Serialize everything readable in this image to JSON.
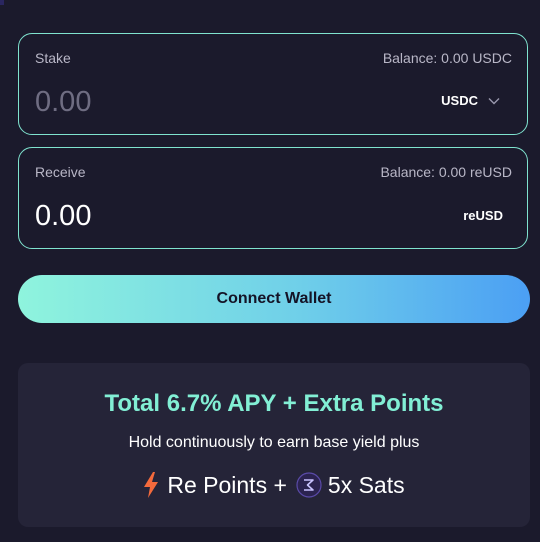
{
  "stake": {
    "label": "Stake",
    "balance": "Balance: 0.00 USDC",
    "amount_placeholder": "0.00",
    "amount_value": "",
    "token": "USDC"
  },
  "receive": {
    "label": "Receive",
    "balance": "Balance: 0.00 reUSD",
    "amount": "0.00",
    "token": "reUSD"
  },
  "actions": {
    "connect_label": "Connect Wallet"
  },
  "promo": {
    "headline": "Total 6.7% APY + Extra Points",
    "subtext": "Hold continuously to earn base yield plus",
    "points_label": "Re Points +",
    "sats_label": "5x Sats"
  },
  "icons": {
    "stake_token_dropdown": "chevron-down-icon",
    "points": "lightning-bolt-icon",
    "sats": "sats-token-icon"
  },
  "colors": {
    "background": "#1b1a2c",
    "card_border": "#7fe3cf",
    "accent_text": "#82efd5",
    "button_gradient_start": "#8ff4dd",
    "button_gradient_end": "#4b9ff4",
    "promo_bg": "#252438",
    "bolt": "#f46a3c"
  }
}
